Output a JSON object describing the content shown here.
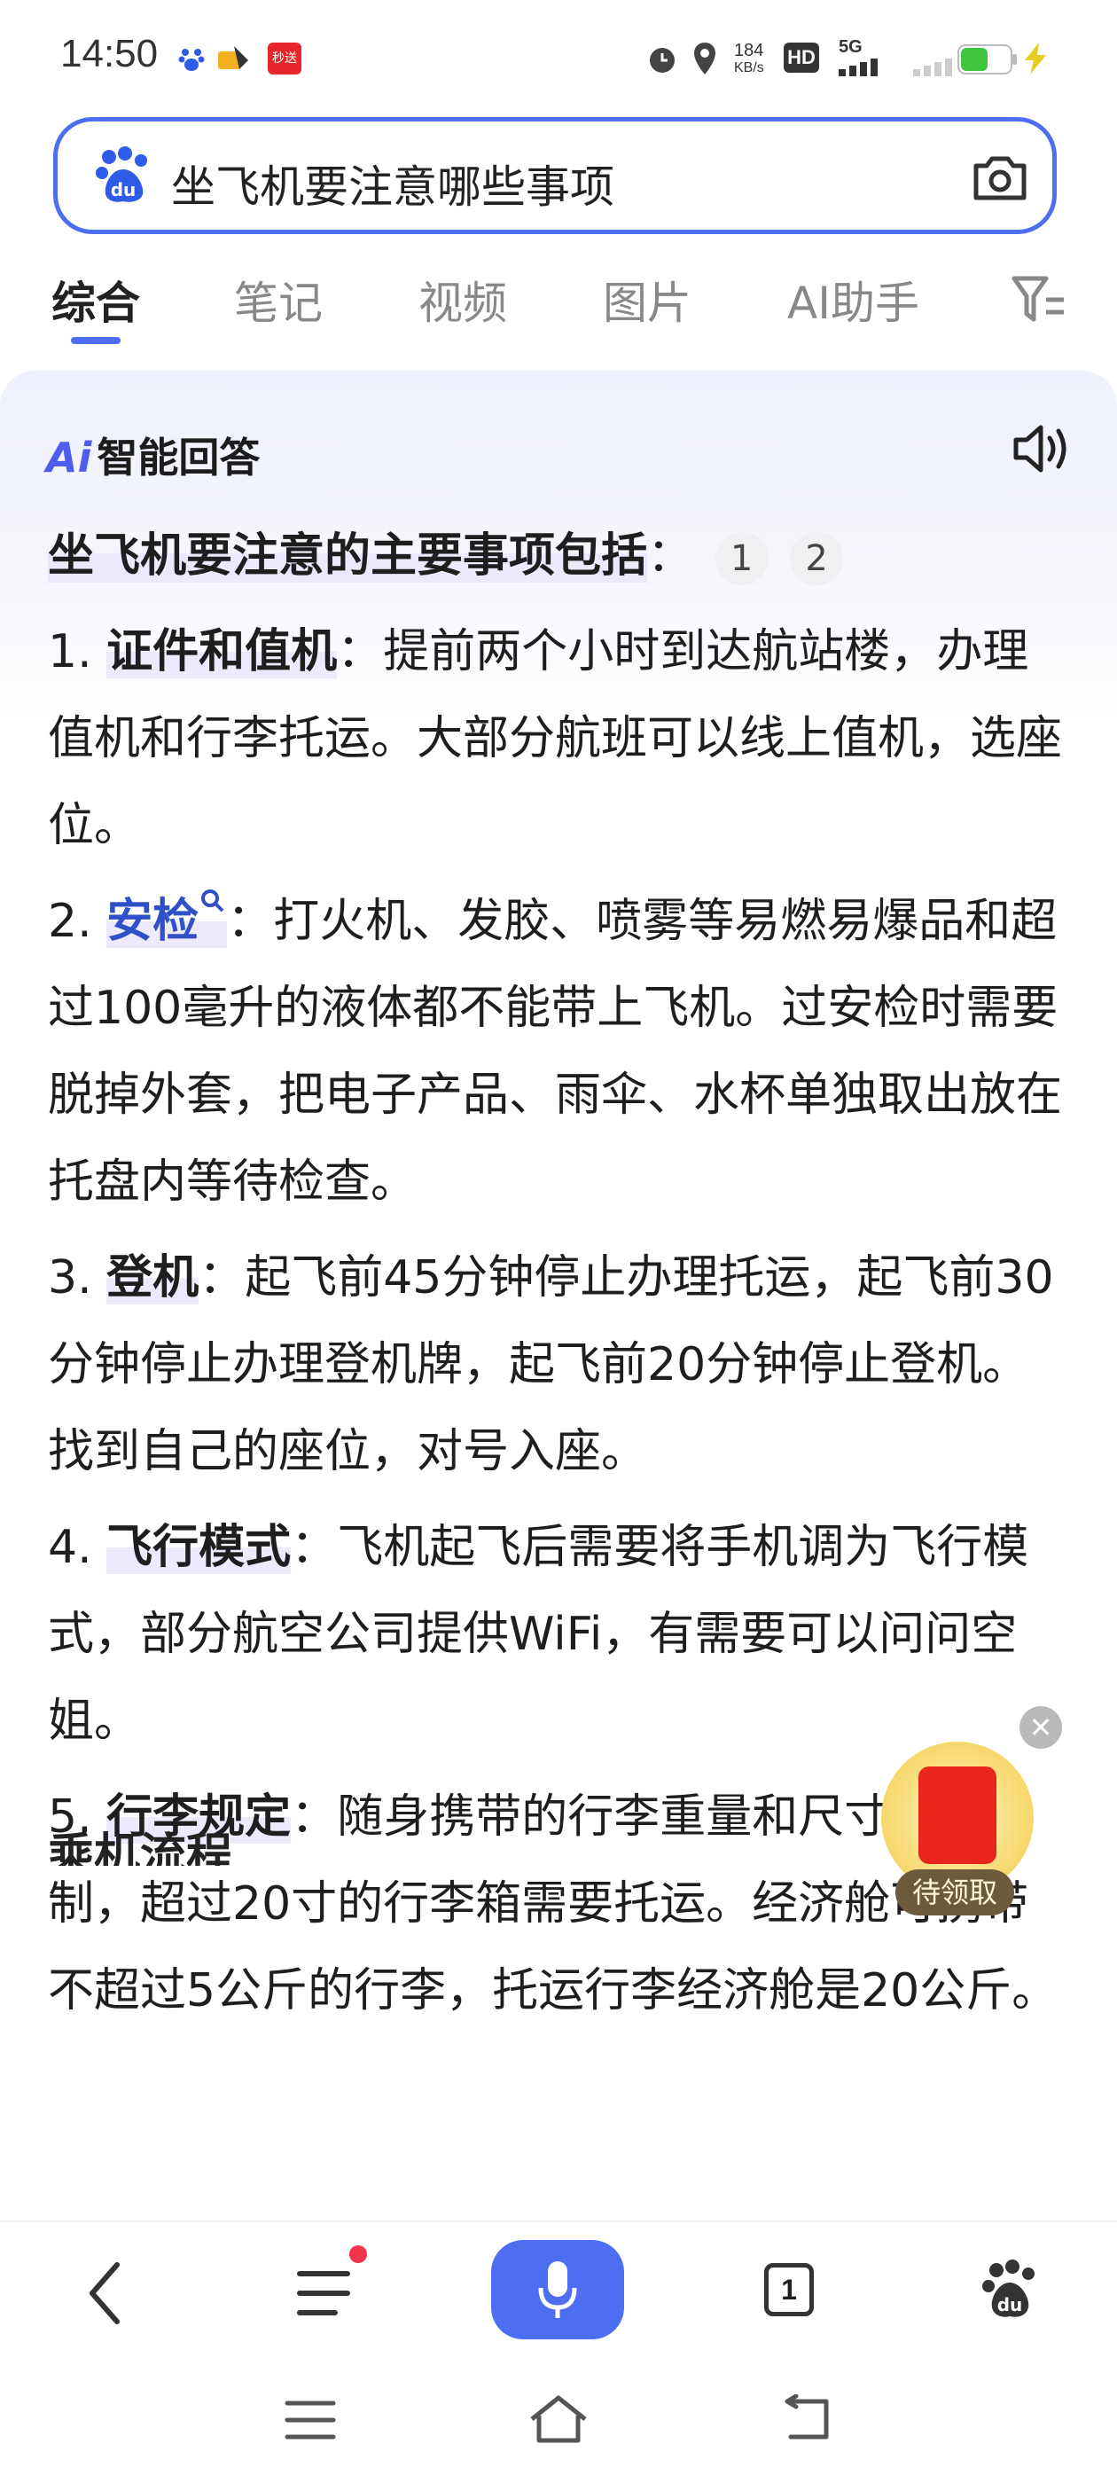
{
  "status_bar": {
    "time": "14:50",
    "speed_value": "184",
    "speed_unit": "KB/s",
    "hd": "HD",
    "network": "5G",
    "icons": [
      "baidu-paw-icon",
      "notification-icon",
      "app-badge-icon",
      "alarm-icon",
      "location-icon",
      "signal-icon",
      "battery-icon",
      "charging-icon"
    ],
    "app_badge": "秒送"
  },
  "search": {
    "query": "坐飞机要注意哪些事项",
    "icons": [
      "baidu-logo-icon",
      "camera-icon"
    ]
  },
  "tabs": [
    {
      "label": "综合",
      "active": true
    },
    {
      "label": "笔记"
    },
    {
      "label": "视频"
    },
    {
      "label": "图片"
    },
    {
      "label": "AI助手"
    }
  ],
  "ai_card": {
    "title": "智能回答",
    "summary": "坐飞机要注意的主要事项包括",
    "citations": [
      "1",
      "2"
    ],
    "items": [
      {
        "num": "1.",
        "title": "证件和值机",
        "text": "提前两个小时到达航站楼，办理值机和行李托运。大部分航班可以线上值机，选座位。"
      },
      {
        "num": "2.",
        "title": "安检",
        "text": "打火机、发胶、喷雾等易燃易爆品和超过100毫升的液体都不能带上飞机。过安检时需要脱掉外套，把电子产品、雨伞、水杯单独取出放在托盘内等待检查。"
      },
      {
        "num": "3.",
        "title": "登机",
        "text": "起飞前45分钟停止办理托运，起飞前30分钟停止办理登机牌，起飞前20分钟停止登机。找到自己的座位，对号入座。"
      },
      {
        "num": "4.",
        "title": "飞行模式",
        "text": "飞机起飞后需要将手机调为飞行模式，部分航空公司提供WiFi，有需要可以问问空姐。"
      },
      {
        "num": "5.",
        "title": "行李规定",
        "text": "随身携带的行李重量和尺寸有限制，超过20寸的行李箱需要托运。经济舱可携带不超过5公斤的行李，托运行李经济舱是20公斤。"
      }
    ],
    "next_heading": "乘机流程"
  },
  "red_packet": {
    "label": "待领取"
  },
  "toolbar": {
    "tab_count": "1"
  },
  "colors": {
    "accent": "#4e6ef2",
    "highlight": "#eceafc",
    "red": "#e8261c"
  }
}
